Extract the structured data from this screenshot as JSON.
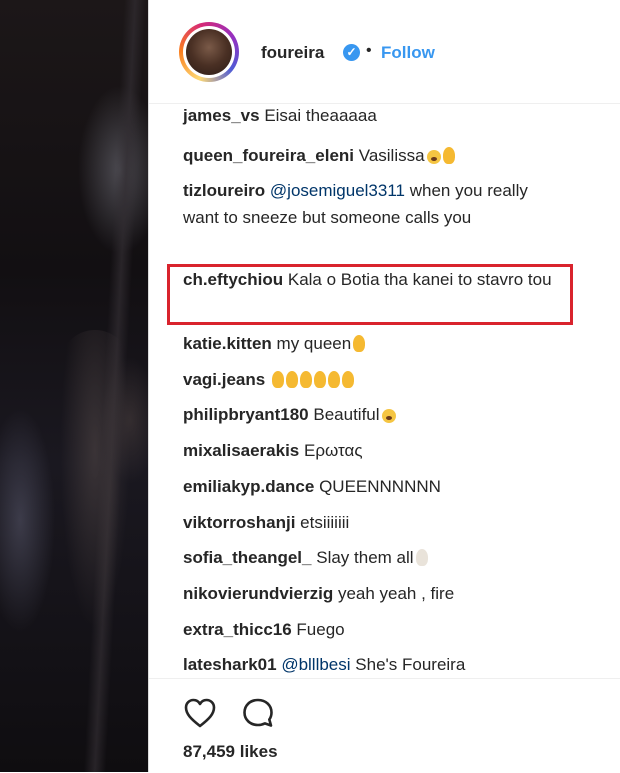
{
  "post": {
    "username": "foureira",
    "separator": "•",
    "follow_label": "Follow"
  },
  "comments": [
    {
      "user": "james_vs",
      "text": "Eisai theaaaaa",
      "emoji": ""
    },
    {
      "user": "queen_foureira_eleni",
      "text": "Vasilissa",
      "emoji": "face-hand"
    },
    {
      "user": "tizloureiro",
      "mention": "@josemiguel3311",
      "text": " when you really want to sneeze but someone calls you"
    },
    {
      "user": "ch.eftychiou",
      "text": "Kala o Botia tha kanei to stavro tou"
    },
    {
      "user": "katie.kitten",
      "text": "my queen",
      "emoji": "hand"
    },
    {
      "user": "vagi.jeans",
      "text": "",
      "emoji": "hands6"
    },
    {
      "user": "philipbryant180",
      "text": "Beautiful",
      "emoji": "face"
    },
    {
      "user": "mixalisaerakis",
      "text": "Ερωτας"
    },
    {
      "user": "emiliakyp.dance",
      "text": "QUEENNNNNN"
    },
    {
      "user": "viktorroshanji",
      "text": "etsiiiiiii"
    },
    {
      "user": "sofia_theangel_",
      "text": "Slay them all",
      "emoji": "pale"
    },
    {
      "user": "nikovierundvierzig",
      "text": "yeah yeah , fire"
    },
    {
      "user": "extra_thicc16",
      "text": "Fuego"
    },
    {
      "user": "lateshark01",
      "mention": "@blllbesi",
      "text": " She's Foureira"
    }
  ],
  "actions": {
    "likes": "87,459 likes"
  },
  "colors": {
    "accent_blue": "#3897f0",
    "highlight_red": "#d9232d",
    "mention": "#003569"
  }
}
